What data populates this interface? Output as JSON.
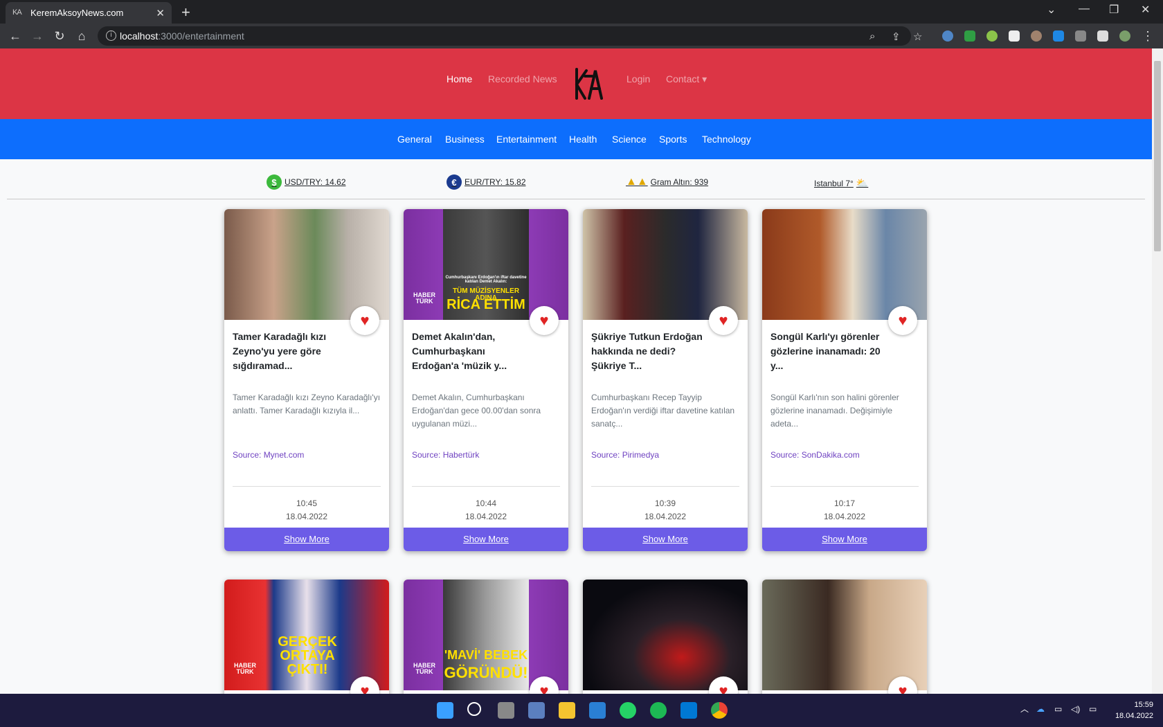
{
  "browser": {
    "tab_title": "KeremAksoyNews.com",
    "tab_favicon": "KA",
    "url_host": "localhost",
    "url_path": ":3000/entertainment"
  },
  "topnav": {
    "home": "Home",
    "recorded": "Recorded News",
    "login": "Login",
    "contact": "Contact ▾"
  },
  "categories": [
    "General",
    "Business",
    "Entertainment",
    "Health",
    "Science",
    "Sports",
    "Technology"
  ],
  "ticker": {
    "usd": "USD/TRY: 14.62",
    "eur": "EUR/TRY: 15.82",
    "gold": "Gram Altın: 939",
    "weather": "Istanbul 7°"
  },
  "cards": [
    {
      "title": "Tamer Karadağlı kızı Zeyno'yu yere göre sığdıramad...",
      "desc": "Tamer Karadağlı kızı Zeyno Karadağlı'yı anlattı. Tamer Karadağlı kızıyla il...",
      "source": "Source: Mynet.com",
      "time": "10:45",
      "date": "18.04.2022",
      "more": "Show More"
    },
    {
      "title": "Demet Akalın'dan, Cumhurbaşkanı Erdoğan'a 'müzik y...",
      "desc": "Demet Akalın, Cumhurbaşkanı Erdoğan'dan gece 00.00'dan sonra uygulanan müzi...",
      "source": "Source: Habertürk",
      "time": "10:44",
      "date": "18.04.2022",
      "more": "Show More"
    },
    {
      "title": "Şükriye Tutkun Erdoğan hakkında ne dedi? Şükriye T...",
      "desc": "Cumhurbaşkanı Recep Tayyip Erdoğan'ın verdiği iftar davetine katılan sanatç...",
      "source": "Source: Pirimedya",
      "time": "10:39",
      "date": "18.04.2022",
      "more": "Show More"
    },
    {
      "title": "Songül Karlı'yı görenler gözlerine inanamadı: 20 y...",
      "desc": "Songül Karlı'nın son halini görenler gözlerine inanamadı. Değişimiyle adeta...",
      "source": "Source: SonDakika.com",
      "time": "10:17",
      "date": "18.04.2022",
      "more": "Show More"
    }
  ],
  "image_captions": {
    "c2_small": "Cumhurbaşkanı Erdoğan'ın iftar davetine katılan Demet Akalın:",
    "c2_big1": "TÜM MÜZİSYENLER ADINA",
    "c2_big2": "RİCA ETTİM",
    "haber": "HABER TÜRK",
    "r2c1": "GERÇEK ORTAYA ÇIKTI!",
    "r2c2a": "'MAVİ' BEBEK",
    "r2c2b": "GÖRÜNDÜ!"
  },
  "taskbar": {
    "time": "15:59",
    "date": "18.04.2022"
  },
  "colors": {
    "topnav": "#dc3545",
    "catnav": "#0d6efd",
    "button": "#6c5ce7",
    "heart": "#e02424"
  }
}
